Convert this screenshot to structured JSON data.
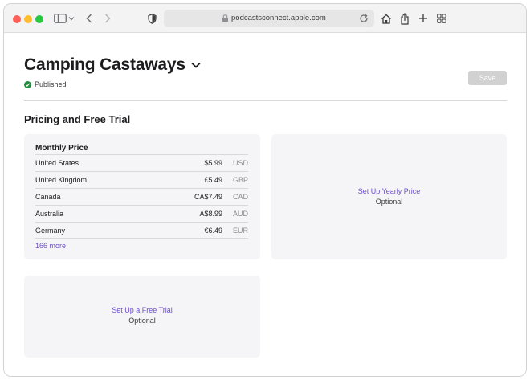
{
  "browser": {
    "url": "podcastsconnect.apple.com"
  },
  "header": {
    "title": "Camping Castaways",
    "status": "Published",
    "save_label": "Save"
  },
  "section": {
    "title": "Pricing and Free Trial"
  },
  "monthly": {
    "heading": "Monthly Price",
    "rows": [
      {
        "country": "United States",
        "amount": "$5.99",
        "currency": "USD"
      },
      {
        "country": "United Kingdom",
        "amount": "£5.49",
        "currency": "GBP"
      },
      {
        "country": "Canada",
        "amount": "CA$7.49",
        "currency": "CAD"
      },
      {
        "country": "Australia",
        "amount": "A$8.99",
        "currency": "AUD"
      },
      {
        "country": "Germany",
        "amount": "€6.49",
        "currency": "EUR"
      }
    ],
    "more_label": "166 more"
  },
  "yearly": {
    "link": "Set Up Yearly Price",
    "note": "Optional"
  },
  "trial": {
    "link": "Set Up a Free Trial",
    "note": "Optional"
  },
  "colors": {
    "accent": "#6e4fc9",
    "published": "#1e8e3e"
  }
}
